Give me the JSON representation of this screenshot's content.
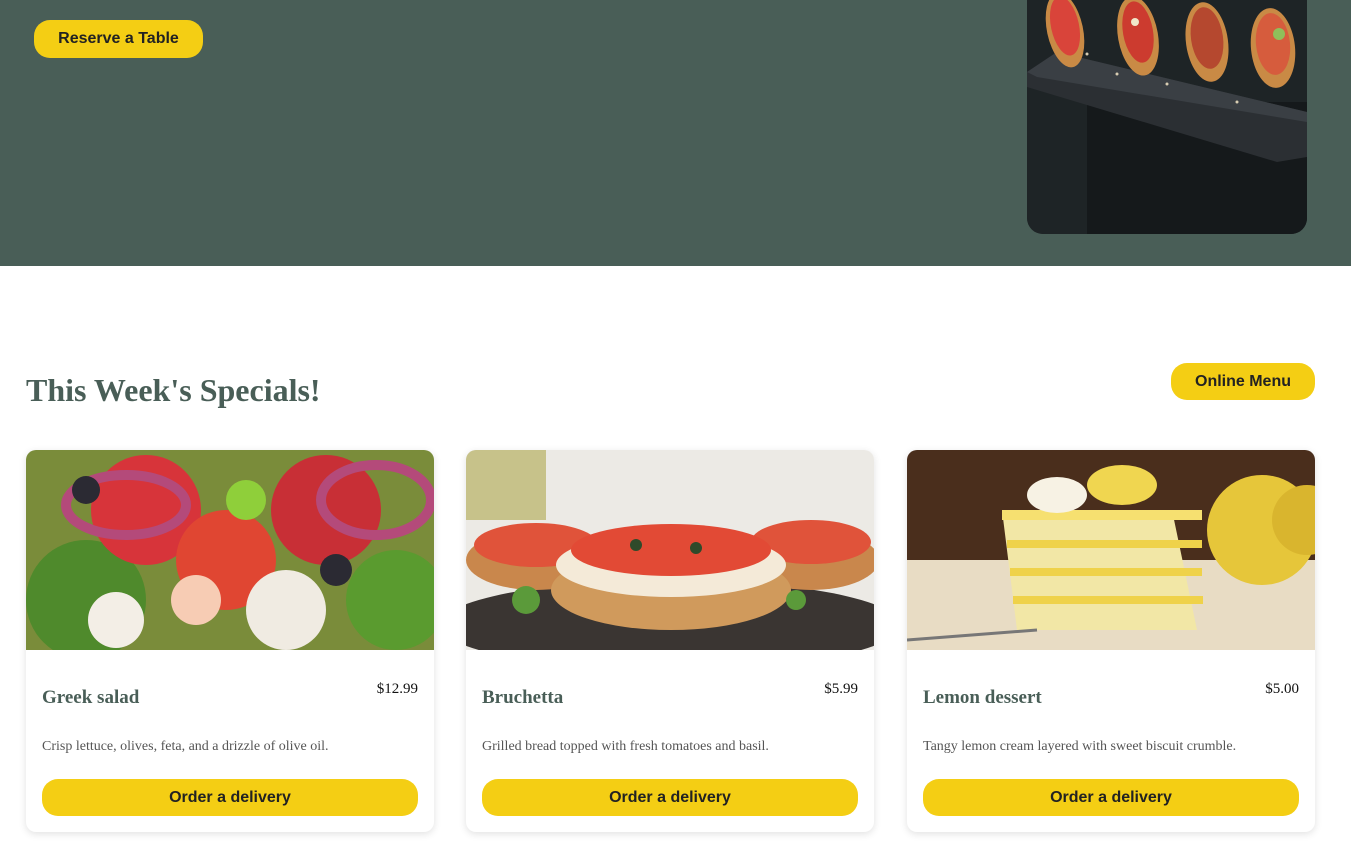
{
  "hero": {
    "reserve_label": "Reserve a Table",
    "image_alt": "Bruschetta appetizers on slate"
  },
  "specials": {
    "title": "This Week's Specials!",
    "online_menu_label": "Online Menu",
    "items": [
      {
        "name": "Greek salad",
        "price": "$12.99",
        "description": "Crisp lettuce, olives, feta, and a drizzle of olive oil.",
        "button_label": "Order a delivery"
      },
      {
        "name": "Bruchetta",
        "price": "$5.99",
        "description": "Grilled bread topped with fresh tomatoes and basil.",
        "button_label": "Order a delivery"
      },
      {
        "name": "Lemon dessert",
        "price": "$5.00",
        "description": "Tangy lemon cream layered with sweet biscuit crumble.",
        "button_label": "Order a delivery"
      }
    ]
  },
  "colors": {
    "primary_green": "#495e57",
    "primary_yellow": "#f4ce14"
  }
}
